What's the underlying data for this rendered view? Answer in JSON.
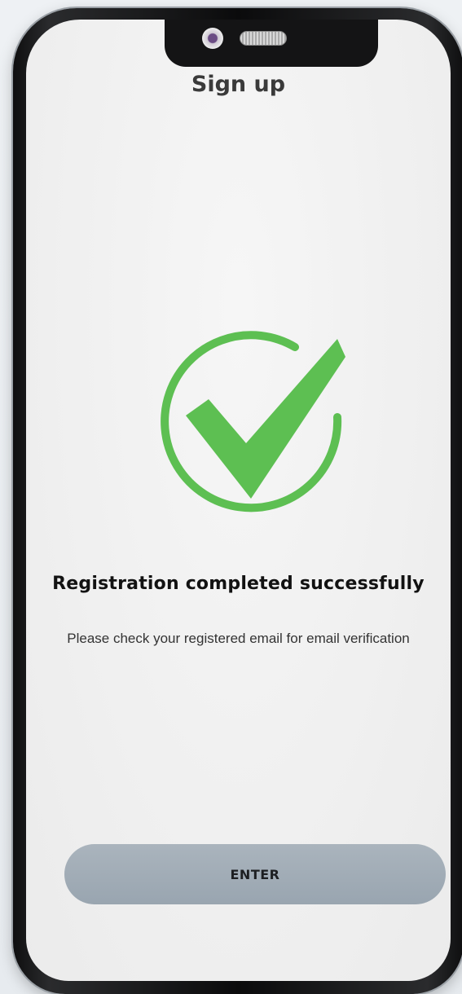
{
  "header": {
    "title": "Sign up"
  },
  "status": {
    "icon": "check-circle-icon",
    "accent_color": "#5dbf52",
    "title": "Registration completed successfully",
    "message": "Please check your registered email for email verification"
  },
  "actions": {
    "enter_label": "ENTER"
  }
}
